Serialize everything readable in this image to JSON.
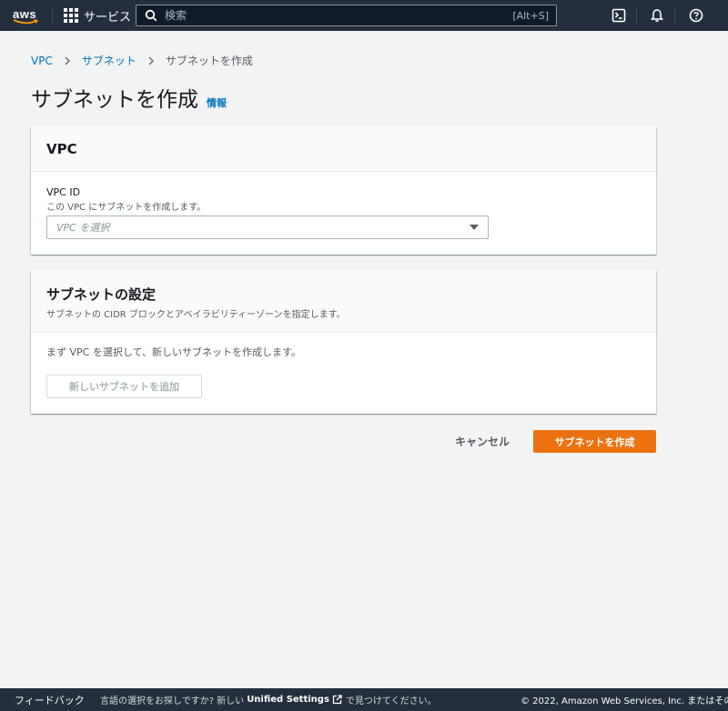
{
  "topnav": {
    "logo_text": "aws",
    "services_label": "サービス",
    "search_placeholder": "検索",
    "search_shortcut": "[Alt+S]"
  },
  "breadcrumb": {
    "items": [
      "VPC",
      "サブネット"
    ],
    "current": "サブネットを作成"
  },
  "page": {
    "title": "サブネットを作成",
    "info_link": "情報"
  },
  "vpc_section": {
    "title": "VPC",
    "field_label": "VPC ID",
    "field_description": "この VPC にサブネットを作成します。",
    "select_placeholder": "VPC を選択"
  },
  "subnet_section": {
    "title": "サブネットの設定",
    "description": "サブネットの CIDR ブロックとアベイラビリティーゾーンを指定します。",
    "body_text": "まず VPC を選択して、新しいサブネットを作成します。",
    "add_button": "新しいサブネットを追加"
  },
  "actions": {
    "cancel": "キャンセル",
    "create": "サブネットを作成"
  },
  "footer": {
    "feedback": "フィードバック",
    "lang_prefix": "言語の選択をお探しですか? 新しい",
    "lang_strong": "Unified Settings",
    "lang_suffix": "で見つけてください。",
    "copyright": "© 2022, Amazon Web Services, Inc. またはその関"
  },
  "colors": {
    "nav_bg": "#232f3e",
    "link": "#0073bb",
    "primary_button": "#ec7211",
    "page_bg": "#f2f3f3"
  },
  "icons": [
    "services-grid-icon",
    "search-icon",
    "cloudshell-icon",
    "notifications-bell-icon",
    "help-icon",
    "chevron-right-icon",
    "caret-down-icon",
    "external-link-icon"
  ]
}
